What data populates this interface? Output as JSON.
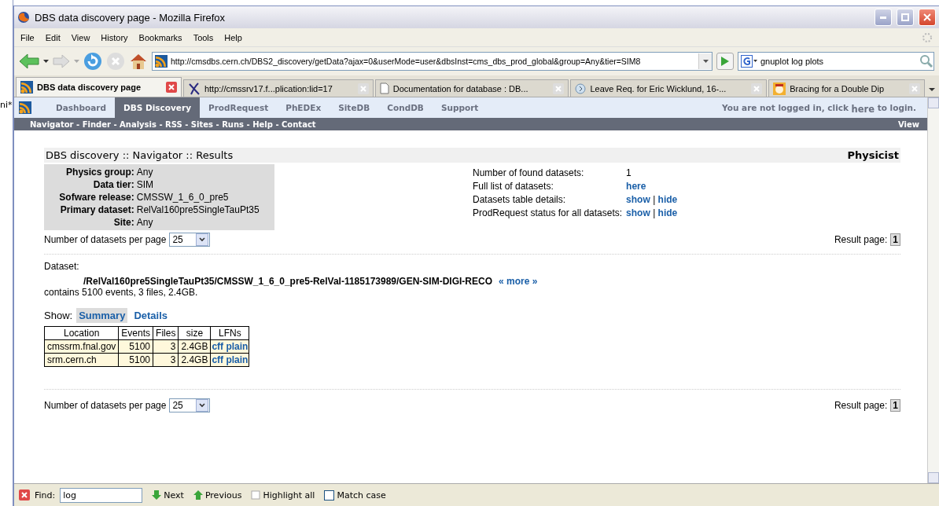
{
  "background": {
    "text": "ni*"
  },
  "window": {
    "title": "DBS data discovery page - Mozilla Firefox"
  },
  "menu": [
    "File",
    "Edit",
    "View",
    "History",
    "Bookmarks",
    "Tools",
    "Help"
  ],
  "toolbar": {
    "url": "http://cmsdbs.cern.ch/DBS2_discovery/getData?ajax=0&userMode=user&dbsInst=cms_dbs_prod_global&group=Any&tier=SIM8",
    "search": "gnuplot log plots"
  },
  "tabs": [
    {
      "label": "DBS data discovery page",
      "selected": true,
      "kind": "dbs"
    },
    {
      "label": "http://cmssrv17.f...plication:lid=17",
      "selected": false,
      "kind": "x"
    },
    {
      "label": "Documentation for database : DB...",
      "selected": false,
      "kind": "doc"
    },
    {
      "label": "Leave Req. for Eric Wicklund, 16-...",
      "selected": false,
      "kind": "circle"
    },
    {
      "label": "Bracing for a Double Dip",
      "selected": false,
      "kind": "comic"
    }
  ],
  "site_nav": {
    "items": [
      {
        "label": "Dashboard",
        "selected": false
      },
      {
        "label": "DBS Discovery",
        "selected": true
      },
      {
        "label": "ProdRequest",
        "selected": false
      },
      {
        "label": "PhEDEx",
        "selected": false
      },
      {
        "label": "SiteDB",
        "selected": false
      },
      {
        "label": "CondDB",
        "selected": false
      },
      {
        "label": "Support",
        "selected": false
      }
    ],
    "login_before": "You are not logged in, click",
    "login_link": "here",
    "login_after": "to login.",
    "sub_links": [
      "Navigator",
      "Finder",
      "Analysis",
      "RSS",
      "Sites",
      "Runs",
      "Help",
      "Contact"
    ],
    "separator": "-",
    "view": "View"
  },
  "heading": {
    "title": "DBS discovery :: Navigator :: Results",
    "role": "Physicist"
  },
  "query": [
    {
      "label": "Physics group:",
      "value": "Any"
    },
    {
      "label": "Data tier:",
      "value": "SIM"
    },
    {
      "label": "Sofware release:",
      "value": "CMSSW_1_6_0_pre5"
    },
    {
      "label": "Primary dataset:",
      "value": "RelVal160pre5SingleTauPt35"
    },
    {
      "label": "Site:",
      "value": "Any"
    }
  ],
  "summary": [
    {
      "label": "Number of found datasets:",
      "kind": "text",
      "values": [
        "1"
      ]
    },
    {
      "label": "Full list of datasets:",
      "kind": "links",
      "values": [
        "here"
      ]
    },
    {
      "label": "Datasets table details:",
      "kind": "links",
      "values": [
        "show",
        "hide"
      ]
    },
    {
      "label": "ProdRequest status for all datasets:",
      "kind": "links",
      "values": [
        "show",
        "hide"
      ]
    }
  ],
  "link_separator": "|",
  "per_page": {
    "label": "Number of datasets per page",
    "value": "25"
  },
  "result_page": {
    "label": "Result page:",
    "page": "1"
  },
  "dataset": {
    "label": "Dataset:",
    "path": "/RelVal160pre5SingleTauPt35/CMSSW_1_6_0_pre5-RelVal-1185173989/GEN-SIM-DIGI-RECO",
    "more": "« more »",
    "contains": "contains 5100 events, 3 files, 2.4GB.",
    "show_label": "Show:",
    "views": [
      {
        "label": "Summary",
        "selected": true
      },
      {
        "label": "Details",
        "selected": false
      }
    ],
    "table": {
      "columns": [
        "Location",
        "Events",
        "Files",
        "size",
        "LFNs"
      ],
      "rows": [
        {
          "location": "cmssrm.fnal.gov",
          "events": "5100",
          "files": "3",
          "size": "2.4GB",
          "lfns": [
            "cff",
            "plain"
          ]
        },
        {
          "location": "srm.cern.ch",
          "events": "5100",
          "files": "3",
          "size": "2.4GB",
          "lfns": [
            "cff",
            "plain"
          ]
        }
      ]
    }
  },
  "per_page_bottom": {
    "label": "Number of datasets per page",
    "value": "25"
  },
  "result_page_bottom": {
    "label": "Result page:",
    "page": "1"
  },
  "find_bar": {
    "label": "Find:",
    "value": "log",
    "next": "Next",
    "previous": "Previous",
    "highlight": "Highlight all",
    "match_case": "Match case",
    "match_case_checked": false
  }
}
